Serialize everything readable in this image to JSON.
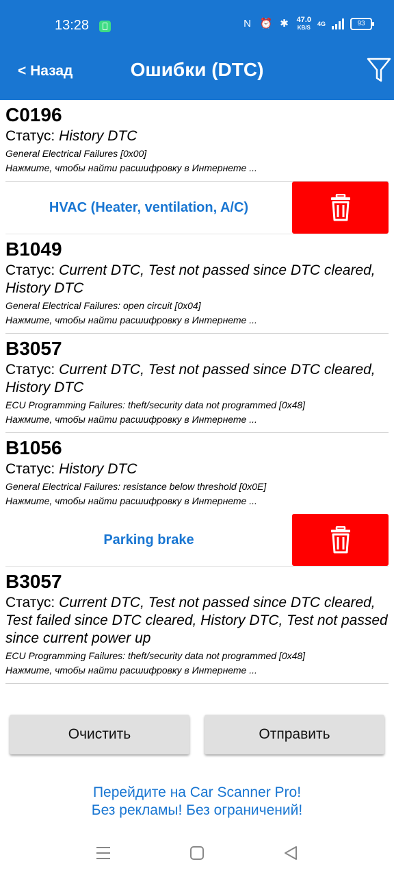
{
  "status_bar": {
    "time": "13:28",
    "speed_value": "47.0",
    "speed_unit": "KB/S",
    "network": "4G",
    "battery": "93"
  },
  "app_bar": {
    "back_label": "< Назад",
    "title": "Ошибки (DTC)",
    "filter_icon": "filter-icon"
  },
  "link_text": "Нажмите, чтобы найти расшифровку в Интернете ...",
  "status_prefix": "Статус: ",
  "dtc_groups": [
    {
      "code": "C0196",
      "status": "History DTC",
      "description": "General Electrical Failures [0x00]"
    }
  ],
  "sections": [
    {
      "title": "HVAC (Heater, ventilation, A/C)",
      "delete_icon": "trash-icon",
      "items": [
        {
          "code": "B1049",
          "status": "Current DTC, Test not passed since DTC cleared, History DTC",
          "description": "General Electrical Failures: open circuit [0x04]"
        },
        {
          "code": "B3057",
          "status": "Current DTC, Test not passed since DTC cleared, History DTC",
          "description": "ECU Programming Failures: theft/security data not programmed [0x48]"
        },
        {
          "code": "B1056",
          "status": "History DTC",
          "description": "General Electrical Failures: resistance below threshold [0x0E]"
        }
      ]
    },
    {
      "title": "Parking brake",
      "delete_icon": "trash-icon",
      "items": [
        {
          "code": "B3057",
          "status": "Current DTC, Test not passed since DTC cleared, Test failed since DTC cleared, History DTC, Test not passed since current power up",
          "description": "ECU Programming Failures: theft/security data not programmed [0x48]"
        }
      ]
    }
  ],
  "buttons": {
    "clear": "Очистить",
    "send": "Отправить"
  },
  "promo": {
    "line1": "Перейдите на Car Scanner Pro!",
    "line2": "Без рекламы! Без ограничений!"
  },
  "colors": {
    "primary": "#1976d2",
    "delete": "#ff0000",
    "button_bg": "#e0e0e0"
  }
}
